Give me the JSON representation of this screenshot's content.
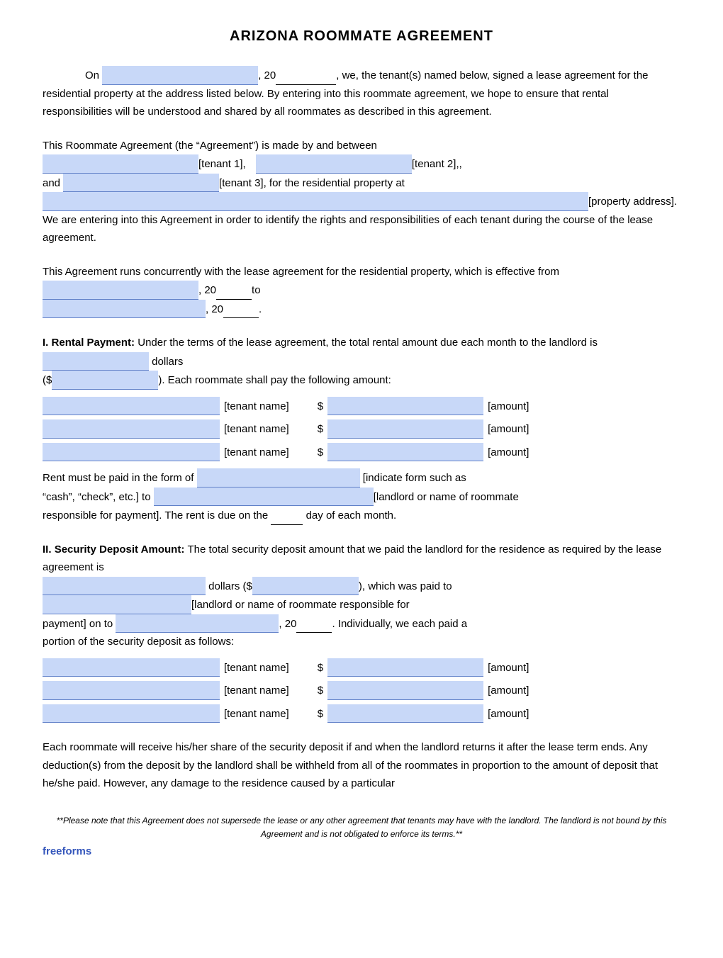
{
  "title": "ARIZONA ROOMMATE AGREEMENT",
  "intro": {
    "line1_pre": "On",
    "line1_mid": ", 20",
    "line1_post": ", we, the tenant(s) named below, signed a lease agreement for the residential property at the address listed below. By entering into this roommate agreement, we hope to ensure that rental responsibilities will be understood and shared by all roommates as described in this agreement."
  },
  "agreement_intro": {
    "text1": "This Roommate Agreement (the “Agreement”) is made by and between",
    "tenant1_label": "[tenant 1],",
    "tenant2_label": "[tenant 2],,",
    "and_text": "and",
    "tenant3_label": "[tenant 3], for the residential property at",
    "property_label": "[property address]. We are entering into this Agreement in order to identify the rights and responsibilities of each tenant during the course of the lease agreement."
  },
  "concurrent": {
    "text1": "This Agreement runs concurrently with the lease agreement for the residential property, which is effective from",
    "mid1": ", 20",
    "to_text": "to",
    "mid2": ", 20",
    "end": "."
  },
  "section1": {
    "heading": "I.",
    "heading2": "Rental Payment:",
    "text1": "Under the terms of the lease agreement, the total rental amount due each month to the landlord is",
    "dollars_label": "dollars",
    "paren_pre": "($",
    "paren_post": "). Each roommate shall pay the following amount:",
    "rows": [
      {
        "tenant_label": "[tenant name]",
        "dollar": "$",
        "amount_label": "[amount]"
      },
      {
        "tenant_label": "[tenant name]",
        "dollar": "$",
        "amount_label": "[amount]"
      },
      {
        "tenant_label": "[tenant name]",
        "dollar": "$",
        "amount_label": "[amount]"
      }
    ],
    "rent_form_pre": "Rent must be paid in the form of",
    "indicate_label": "[indicate form such as “cash”, “check”, etc.] to",
    "landlord_label": "[landlord or name of roommate responsible for payment]. The rent is due on the",
    "day_label": "day of each month."
  },
  "section2": {
    "heading": "II.",
    "heading2": "Security Deposit Amount:",
    "text1": "The total security deposit amount that we paid the landlord for the residence as required by the lease agreement is",
    "dollars_label": "dollars ($",
    "which_label": "), which was paid to",
    "landlord_label": "[landlord or name of roommate responsible for payment] on to",
    "date_mid": ", 20",
    "date_post": ". Individually, we each paid a portion of the security deposit as follows:",
    "rows": [
      {
        "tenant_label": "[tenant name]",
        "dollar": "$",
        "amount_label": "[amount]"
      },
      {
        "tenant_label": "[tenant name]",
        "dollar": "$",
        "amount_label": "[amount]"
      },
      {
        "tenant_label": "[tenant name]",
        "dollar": "$",
        "amount_label": "[amount]"
      }
    ]
  },
  "closing_para": "Each roommate will receive his/her share of the security deposit if and when the landlord returns it after the lease term ends. Any deduction(s) from the deposit by the landlord shall be withheld from all of the roommates in proportion to the amount of deposit that he/she paid. However, any damage to the residence caused by a particular",
  "footer": {
    "note": "**Please note that this Agreement does not supersede the lease or any other agreement that tenants may have with the landlord. The landlord is not bound by this Agreement and is not obligated to enforce its terms.**",
    "brand": "freeforms"
  }
}
